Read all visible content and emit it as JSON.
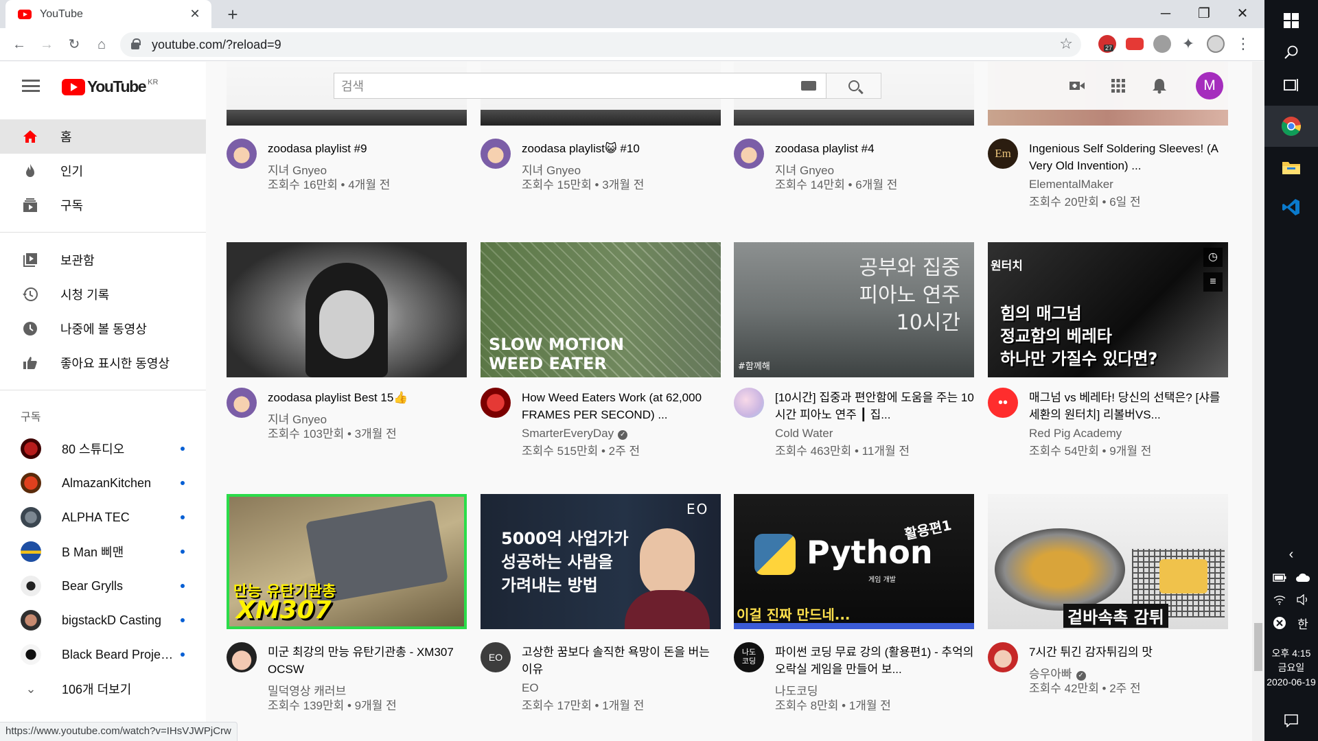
{
  "browser": {
    "tab_title": "YouTube",
    "url": "youtube.com/?reload=9",
    "ext_badge": "27",
    "status_url": "https://www.youtube.com/watch?v=IHsVJWPjCrw"
  },
  "masthead": {
    "logo_text": "YouTube",
    "logo_region": "KR",
    "search_placeholder": "검색",
    "avatar_letter": "M"
  },
  "sidebar": {
    "main": [
      "홈",
      "인기",
      "구독"
    ],
    "library": [
      "보관함",
      "시청 기록",
      "나중에 볼 동영상",
      "좋아요 표시한 동영상"
    ],
    "subs_title": "구독",
    "subscriptions": [
      "80 스튜디오",
      "AlmazanKitchen",
      "ALPHA TEC",
      "B Man 삐맨",
      "Bear Grylls",
      "bigstackD Casting",
      "Black Beard Projec..."
    ],
    "more": "106개 더보기"
  },
  "videos": [
    {
      "title": "zoodasa playlist #9",
      "channel": "지녀 Gnyeo",
      "stats": "조회수 16만회 • 4개월 전"
    },
    {
      "title": "zoodasa playlist😺 #10",
      "channel": "지녀 Gnyeo",
      "stats": "조회수 15만회 • 3개월 전"
    },
    {
      "title": "zoodasa playlist #4",
      "channel": "지녀 Gnyeo",
      "stats": "조회수 14만회 • 6개월 전"
    },
    {
      "title": "Ingenious Self Soldering Sleeves! (A Very Old Invention) ...",
      "channel": "ElementalMaker",
      "stats": "조회수 20만회 • 6일 전"
    },
    {
      "title": "zoodasa playlist Best 15👍",
      "channel": "지녀 Gnyeo",
      "stats": "조회수 103만회 • 3개월 전"
    },
    {
      "title": "How Weed Eaters Work (at 62,000 FRAMES PER SECOND) ...",
      "channel": "SmarterEveryDay",
      "stats": "조회수 515만회 • 2주 전",
      "thumb_text": [
        "SLOW MOTION",
        "WEED EATER"
      ]
    },
    {
      "title": "[10시간] 집중과 편안함에 도움을 주는 10시간 피아노 연주 ┃ 집...",
      "channel": "Cold Water",
      "stats": "조회수 463만회 • 11개월 전",
      "thumb_text": [
        "공부와 집중",
        "피아노 연주",
        "10시간",
        "#함께해"
      ]
    },
    {
      "title": "매그넘 vs 베레타! 당신의 선택은? [샤를세환의 원터치] 리볼버VS...",
      "channel": "Red Pig Academy",
      "stats": "조회수 54만회 • 9개월 전",
      "thumb_text": [
        "힘의 매그넘",
        "정교함의 베레타",
        "하나만 가질수 있다면?",
        "원터치"
      ]
    },
    {
      "title": "미군 최강의 만능 유탄기관총 - XM307 OCSW",
      "channel": "밀덕영상 캐러브",
      "stats": "조회수 139만회 • 9개월 전",
      "thumb_text": [
        "만능 유탄기관총",
        "XM307"
      ]
    },
    {
      "title": "고상한 꿈보다 솔직한 욕망이 돈을 버는 이유",
      "channel": "EO",
      "stats": "조회수 17만회 • 1개월 전",
      "thumb_text": [
        "5000억 사업가가",
        "성공하는 사람을",
        "가려내는 방법",
        "EO"
      ],
      "channel_avatar": "EO"
    },
    {
      "title": "파이썬 코딩 무료 강의 (활용편1) - 추억의 오락실 게임을 만들어 보...",
      "channel": "나도코딩",
      "stats": "조회수 8만회 • 1개월 전",
      "thumb_text": [
        "Python",
        "활용편1",
        "게임 개발",
        "이걸 진짜 만드네..."
      ],
      "channel_avatar": "나도\n코딩"
    },
    {
      "title": "7시간 튀긴 감자튀김의 맛",
      "channel": "승우아빠",
      "stats": "조회수 42만회 • 2주 전",
      "thumb_text": [
        "겉바속촉 감튀"
      ]
    }
  ],
  "taskbar": {
    "time": "오후 4:15",
    "day": "금요일",
    "date": "2020-06-19",
    "ime": "한"
  },
  "colors": {
    "yt_red": "#ff0000",
    "avatar_m": "#a52dbd",
    "sub_dot": "#065fd4",
    "highlight_border": "#2bdc4a"
  }
}
